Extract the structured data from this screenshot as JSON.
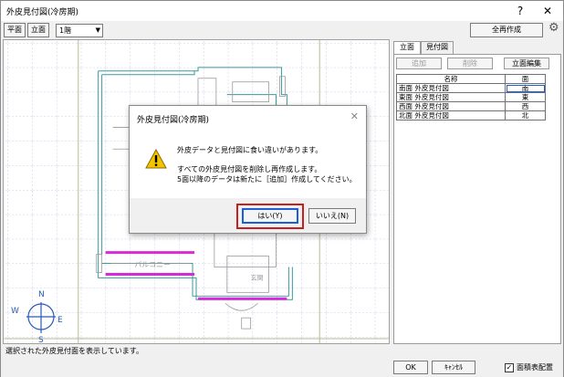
{
  "window": {
    "title": "外皮見付図(冷房期)",
    "help_label": "?",
    "close_label": "✕"
  },
  "toolbar": {
    "plan_label": "平面",
    "elevation_label": "立面",
    "floor_value": "1階",
    "regenerate_all_label": "全再作成"
  },
  "canvas": {
    "balcony_label": "バルコニー",
    "entrance_label": "玄関",
    "compass": {
      "n": "N",
      "e": "E",
      "s": "S",
      "w": "W"
    }
  },
  "statusbar": {
    "text": "選択された外皮見付面を表示しています。"
  },
  "side_panel": {
    "tabs": [
      {
        "label": "立面",
        "active": true
      },
      {
        "label": "見付図",
        "active": false
      }
    ],
    "add_label": "追加",
    "delete_label": "削除",
    "edit_elevation_label": "立面編集",
    "table": {
      "headers": [
        "名称",
        "面"
      ],
      "rows": [
        {
          "name": "南面 外皮見付図",
          "face": "南",
          "selected": true
        },
        {
          "name": "東面 外皮見付図",
          "face": "東",
          "selected": false
        },
        {
          "name": "西面 外皮見付図",
          "face": "西",
          "selected": false
        },
        {
          "name": "北面 外皮見付図",
          "face": "北",
          "selected": false
        }
      ]
    }
  },
  "bottom": {
    "ok_label": "OK",
    "cancel_label": "ｷｬﾝｾﾙ",
    "area_table_label": "面積表配置",
    "area_table_checked": true
  },
  "dialog": {
    "title": "外皮見付図(冷房期)",
    "close_label": "✕",
    "message_line1": "外皮データと見付図に食い違いがあります。",
    "message_line2": "すべての外皮見付図を削除し再作成します。",
    "message_line3": "5面以降のデータは新たに［追加］作成してください。",
    "yes_label": "はい(Y)",
    "no_label": "いいえ(N)"
  },
  "colors": {
    "highlight": "#c61f1f",
    "magenta": "#d62bd6",
    "wall": "#3a9a9a",
    "grid": "#b9b9e0",
    "compass": "#2a5ab8"
  }
}
